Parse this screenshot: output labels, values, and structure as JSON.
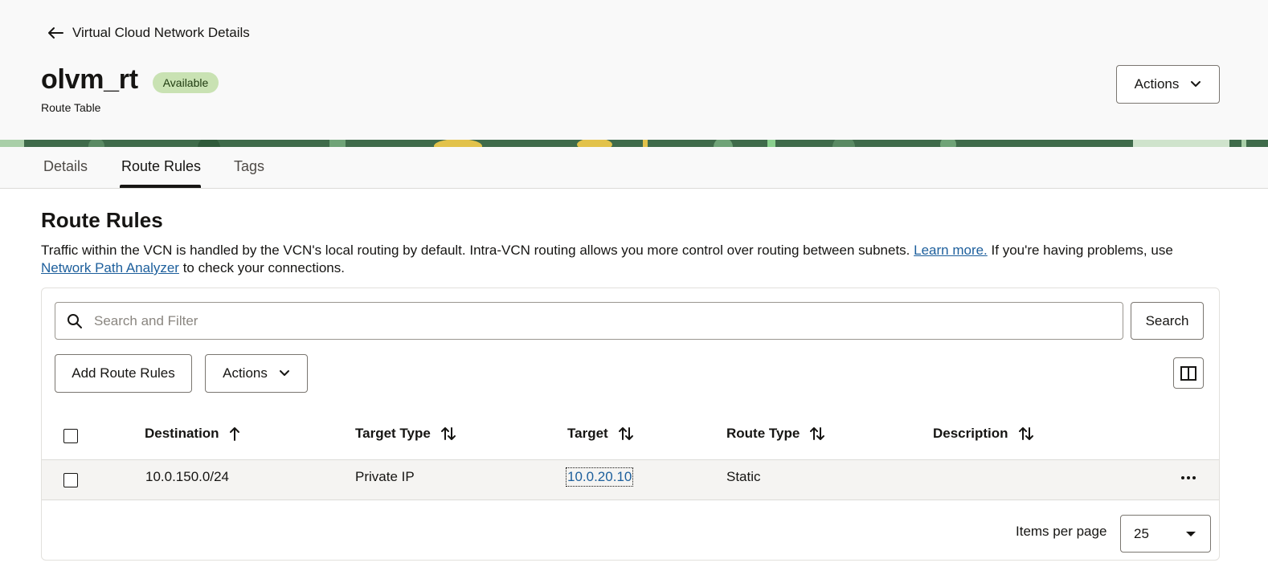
{
  "breadcrumb": {
    "back_label": "Virtual Cloud Network Details"
  },
  "header": {
    "title": "olvm_rt",
    "status": "Available",
    "subtitle": "Route Table",
    "actions_label": "Actions"
  },
  "tabs": [
    {
      "label": "Details",
      "active": false
    },
    {
      "label": "Route Rules",
      "active": true
    },
    {
      "label": "Tags",
      "active": false
    }
  ],
  "section": {
    "title": "Route Rules",
    "desc_part1": "Traffic within the VCN is handled by the VCN's local routing by default. Intra-VCN routing allows you more control over routing between subnets. ",
    "learn_more": "Learn more.",
    "desc_part2": " If you're having problems, use ",
    "path_analyzer": "Network Path Analyzer",
    "desc_part3": " to check your connections."
  },
  "toolbar": {
    "search_placeholder": "Search and Filter",
    "search_button": "Search",
    "add_button": "Add Route Rules",
    "actions_button": "Actions"
  },
  "table": {
    "columns": [
      "Destination",
      "Target Type",
      "Target",
      "Route Type",
      "Description"
    ],
    "rows": [
      {
        "destination": "10.0.150.0/24",
        "target_type": "Private IP",
        "target": "10.0.20.10",
        "route_type": "Static",
        "description": ""
      }
    ]
  },
  "pagination": {
    "items_per_page_label": "Items per page",
    "items_per_page_value": "25"
  },
  "colors": {
    "accent_link": "#1d5f9c",
    "status_badge_bg": "#c9e2b3",
    "banner_green": "#3f6b4a"
  }
}
